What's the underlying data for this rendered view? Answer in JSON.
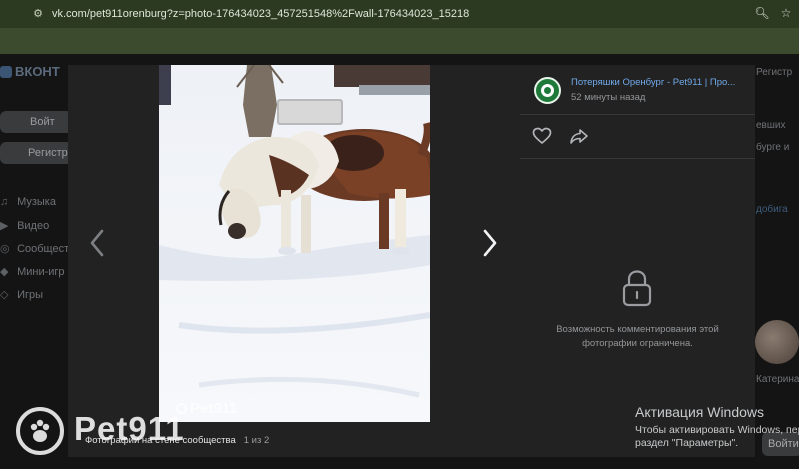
{
  "browser": {
    "url": "vk.com/pet911orenburg?z=photo-176434023_457251548%2Fwall-176434023_15218",
    "zoom_icon": "zoom-icon",
    "star_icon": "bookmark-star-icon"
  },
  "background": {
    "logo": "ВКОНТ",
    "login_button": "Войт",
    "register_button": "Регистр",
    "menu": [
      {
        "label": "Музыка",
        "icon": "music-icon"
      },
      {
        "label": "Видео",
        "icon": "video-icon"
      },
      {
        "label": "Сообщест",
        "icon": "community-icon"
      },
      {
        "label": "Мини-игр",
        "icon": "games-icon"
      },
      {
        "label": "Игры",
        "icon": "games-icon"
      }
    ],
    "right_register": "Регистр",
    "right_lines": [
      "евших",
      "бурге и"
    ],
    "right_link": "добига",
    "right_name": "Катерина",
    "right_button": "Войти"
  },
  "viewer": {
    "caption": "Фотографии на стене сообщества",
    "counter": "1 из 2"
  },
  "panel": {
    "group_name": "Потеряшки Оренбург - Pet911 | Про...",
    "time": "52 минуты назад",
    "restriction_text": "Возможность комментирования этой фотографии ограничена."
  },
  "windows": {
    "title": "Активация Windows",
    "line1": "Чтобы активировать Windows, пер",
    "line2": "раздел \"Параметры\"."
  },
  "watermark": {
    "text": "Pet911",
    "photo_text": "Pet911"
  },
  "colors": {
    "link": "#71aaeb",
    "panel_bg": "#222222",
    "chrome_bg": "#3c4a2e"
  }
}
